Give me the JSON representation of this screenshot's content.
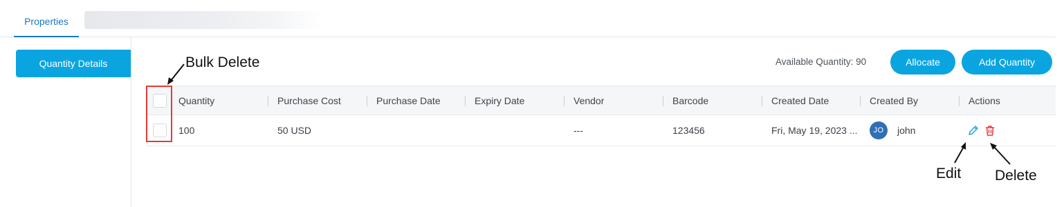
{
  "tabs": {
    "active_label": "Properties"
  },
  "sidebar": {
    "button_label": "Quantity Details"
  },
  "toolbar": {
    "available_quantity": "Available Quantity: 90",
    "allocate_label": "Allocate",
    "add_quantity_label": "Add Quantity"
  },
  "table": {
    "headers": {
      "quantity": "Quantity",
      "purchase_cost": "Purchase Cost",
      "purchase_date": "Purchase Date",
      "expiry_date": "Expiry Date",
      "vendor": "Vendor",
      "barcode": "Barcode",
      "created_date": "Created Date",
      "created_by": "Created By",
      "actions": "Actions"
    },
    "rows": [
      {
        "quantity": "100",
        "purchase_cost": "50 USD",
        "purchase_date": "",
        "expiry_date": "",
        "vendor": "---",
        "barcode": "123456",
        "created_date": "Fri, May 19, 2023 ...",
        "created_by_initials": "JO",
        "created_by_name": "john"
      }
    ]
  },
  "annotations": {
    "bulk_delete": "Bulk Delete",
    "edit": "Edit",
    "delete": "Delete"
  },
  "colors": {
    "accent": "#0aa5e0",
    "tab_active": "#1777c7",
    "avatar": "#2f6fb5",
    "edit_icon": "#1fa2e0",
    "delete_icon": "#e53935",
    "highlight": "#e53935"
  },
  "icons": {
    "edit": "pencil-icon",
    "delete": "trash-icon"
  }
}
